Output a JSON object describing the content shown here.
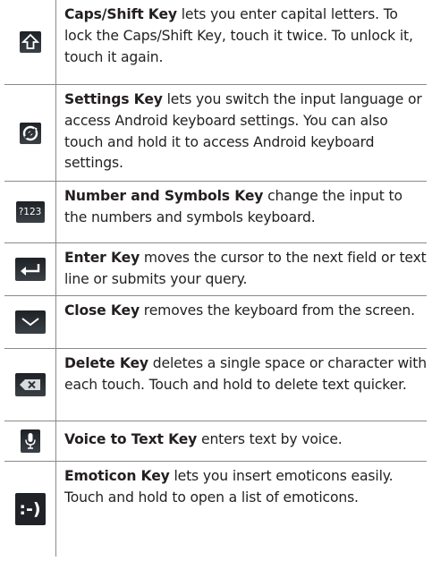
{
  "rows": [
    {
      "icon": "caps-shift-arrow-icon",
      "name": "Caps/Shift Key",
      "text": " lets you enter capital letters. To lock the Caps/Shift Key, touch it twice. To unlock it, touch it again."
    },
    {
      "icon": "settings-gear-icon",
      "name": "Settings Key",
      "text": " lets you switch the input language or access Android keyboard settings. You can also touch and hold it to access Android keyboard settings."
    },
    {
      "icon": "number-symbols-icon",
      "icon_label": "?123",
      "name": "Number and Symbols Key",
      "text": " change the input to the numbers and symbols keyboard."
    },
    {
      "icon": "enter-arrow-icon",
      "name": "Enter Key",
      "text": " moves the cursor to the next field or text line or submits your query."
    },
    {
      "icon": "close-chevron-down-icon",
      "name": "Close Key",
      "text": " removes the keyboard from the screen."
    },
    {
      "icon": "delete-backspace-icon",
      "name": "Delete Key",
      "text": " deletes a single space or character with each touch. Touch and hold to delete text quicker."
    },
    {
      "icon": "microphone-icon",
      "name": "Voice to Text Key",
      "text": " enters text by voice."
    },
    {
      "icon": "emoticon-icon",
      "icon_label": ":-)",
      "name": "Emoticon Key",
      "text": " lets you insert emoticons easily. Touch and hold to open a list of emoticons."
    }
  ],
  "colors": {
    "key_background": "#2b3035",
    "key_glyph": "#ffffff",
    "border": "#8a8a8a"
  }
}
